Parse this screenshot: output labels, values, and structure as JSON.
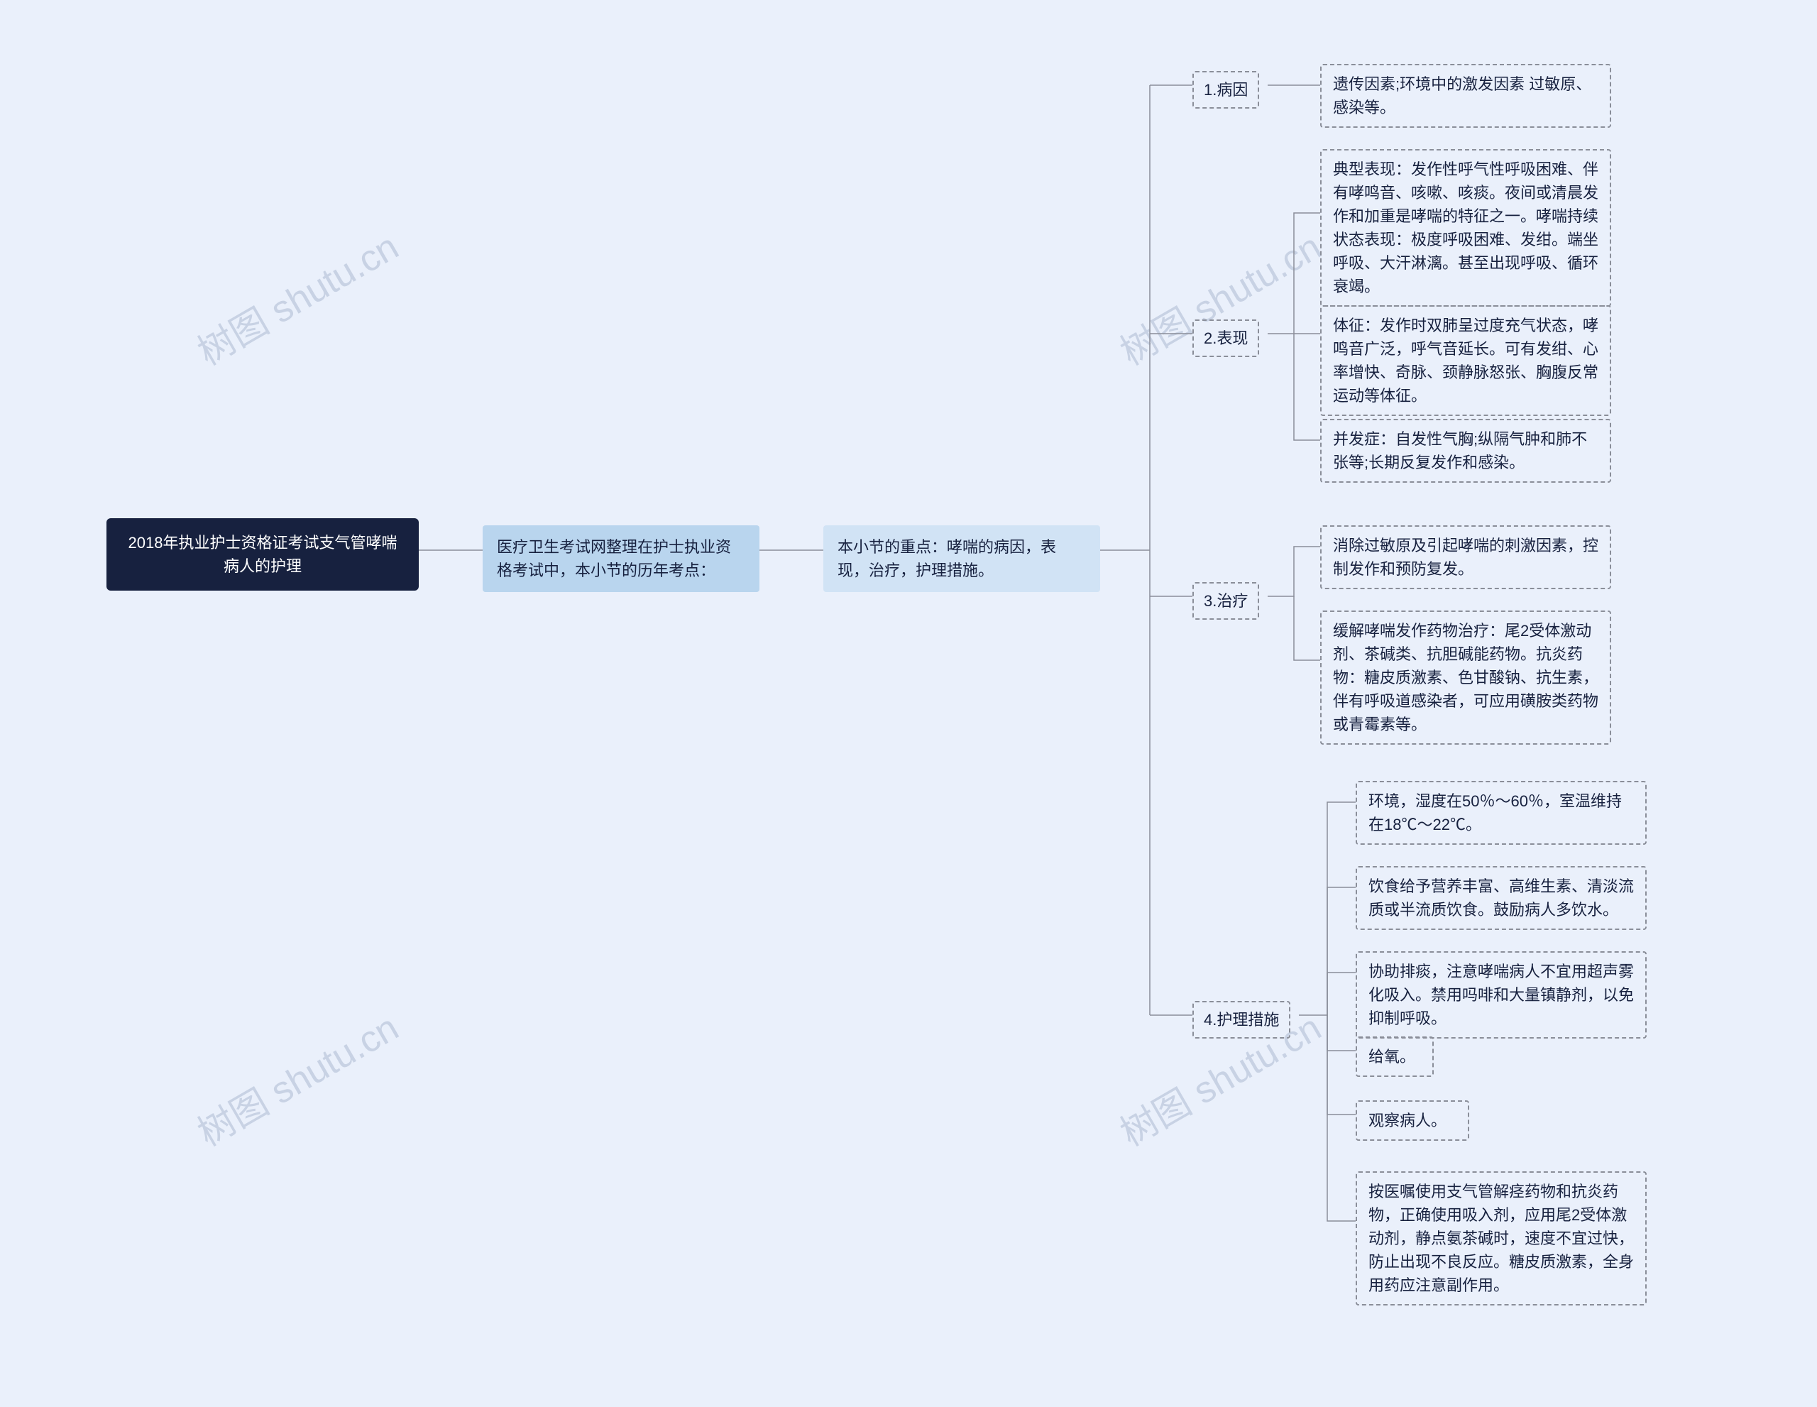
{
  "watermark": "树图 shutu.cn",
  "root": {
    "title": "2018年执业护士资格证考试支气管哮喘病人的护理"
  },
  "lvl1": {
    "text": "医疗卫生考试网整理在护士执业资格考试中，本小节的历年考点："
  },
  "lvl2": {
    "text": "本小节的重点：哮喘的病因，表现，治疗，护理措施。"
  },
  "sections": {
    "s1": {
      "label": "1.病因",
      "items": [
        "遗传因素;环境中的激发因素 过敏原、感染等。"
      ]
    },
    "s2": {
      "label": "2.表现",
      "items": [
        "典型表现：发作性呼气性呼吸困难、伴有哮鸣音、咳嗽、咳痰。夜间或清晨发作和加重是哮喘的特征之一。哮喘持续状态表现：极度呼吸困难、发绀。端坐呼吸、大汗淋漓。甚至出现呼吸、循环衰竭。",
        "体征：发作时双肺呈过度充气状态，哮鸣音广泛，呼气音延长。可有发绀、心率增快、奇脉、颈静脉怒张、胸腹反常运动等体征。",
        "并发症：自发性气胸;纵隔气肿和肺不张等;长期反复发作和感染。"
      ]
    },
    "s3": {
      "label": "3.治疗",
      "items": [
        "消除过敏原及引起哮喘的刺激因素，控制发作和预防复发。",
        "缓解哮喘发作药物治疗：尾2受体激动剂、茶碱类、抗胆碱能药物。抗炎药物：糖皮质激素、色甘酸钠、抗生素，伴有呼吸道感染者，可应用磺胺类药物或青霉素等。"
      ]
    },
    "s4": {
      "label": "4.护理措施",
      "items": [
        "环境，湿度在50％～60％，室温维持在18℃～22℃。",
        "饮食给予营养丰富、高维生素、清淡流质或半流质饮食。鼓励病人多饮水。",
        "协助排痰，注意哮喘病人不宜用超声雾化吸入。禁用吗啡和大量镇静剂，以免抑制呼吸。",
        "给氧。",
        "观察病人。",
        "按医嘱使用支气管解痉药物和抗炎药物，正确使用吸入剂，应用尾2受体激动剂，静点氨茶碱时，速度不宜过快，防止出现不良反应。糖皮质激素，全身用药应注意副作用。"
      ]
    }
  }
}
